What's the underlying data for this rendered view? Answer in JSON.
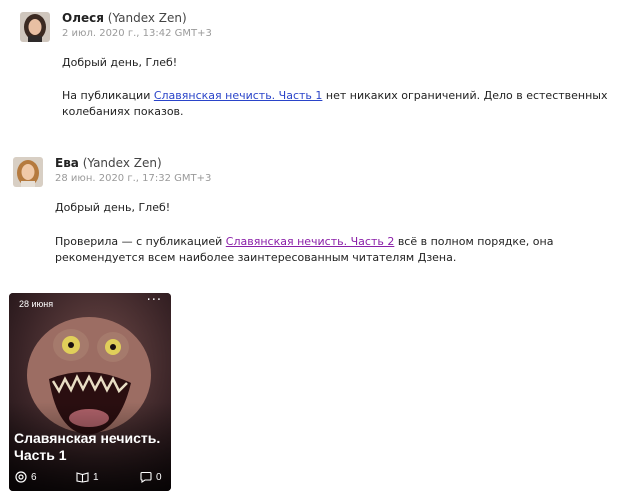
{
  "messages": [
    {
      "sender_name": "Олеся",
      "sender_org": "(Yandex Zen)",
      "date": "2 июл. 2020 г., 13:42 GMT+3",
      "greeting": "Добрый день, Глеб!",
      "body_pre": "На публикации ",
      "body_link": "Славянская нечисть. Часть 1",
      "body_post": " нет никаких ограничений. Дело в естественных колебаниях показов."
    },
    {
      "sender_name": "Ева",
      "sender_org": "(Yandex Zen)",
      "date": "28 июн. 2020 г., 17:32 GMT+3",
      "greeting": "Добрый день, Глеб!",
      "body_pre": "Проверила — с публикацией ",
      "body_link": "Славянская нечисть. Часть 2",
      "body_post": " всё в полном порядке, она рекомендуется всем наиболее заинтересованным читателям Дзена."
    }
  ],
  "card": {
    "date": "28 июня",
    "more": "···",
    "title": "Славянская нечисть. Часть 1",
    "views": "6",
    "reads": "1",
    "comments": "0"
  },
  "icons": [
    "avatar-olesya",
    "avatar-eva",
    "more-icon",
    "views-icon",
    "reads-icon",
    "comments-icon"
  ]
}
